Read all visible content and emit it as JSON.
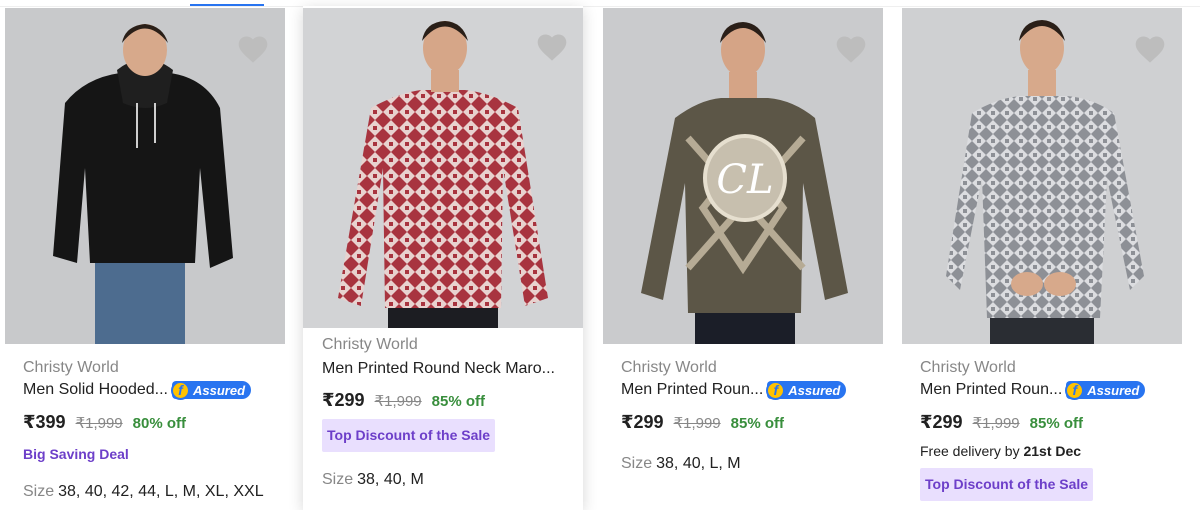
{
  "products": [
    {
      "brand": "Christy World",
      "title": "Men Solid Hooded...",
      "assured": "Assured",
      "price": "₹399",
      "mrp": "₹1,999",
      "discount": "80% off",
      "deal_label": "Big Saving Deal",
      "size_label": "Size",
      "sizes": "38, 40, 42, 44, L, M, XL, XXL",
      "icon": "heart-icon",
      "sweater_color": "#151515"
    },
    {
      "brand": "Christy World",
      "title": "Men Printed Round Neck Maro...",
      "price": "₹299",
      "mrp": "₹1,999",
      "discount": "85% off",
      "tag": "Top Discount of the Sale",
      "size_label": "Size",
      "sizes": "38, 40, M",
      "icon": "heart-icon",
      "sweater_color": "#a8343f"
    },
    {
      "brand": "Christy World",
      "title": "Men Printed Roun...",
      "assured": "Assured",
      "price": "₹299",
      "mrp": "₹1,999",
      "discount": "85% off",
      "size_label": "Size",
      "sizes": "38, 40, L, M",
      "icon": "heart-icon",
      "sweater_color": "#5c5647"
    },
    {
      "brand": "Christy World",
      "title": "Men Printed Roun...",
      "assured": "Assured",
      "price": "₹299",
      "mrp": "₹1,999",
      "discount": "85% off",
      "delivery_prefix": "Free delivery by",
      "delivery_date": "21st Dec",
      "tag": "Top Discount of the Sale",
      "icon": "heart-icon",
      "sweater_color": "#8d9096"
    }
  ],
  "colors": {
    "accent": "#2874f0",
    "discount_green": "#388e3c",
    "tag_purple": "#6d3fc9",
    "tag_bg": "#e9dffe",
    "muted": "#878787"
  }
}
